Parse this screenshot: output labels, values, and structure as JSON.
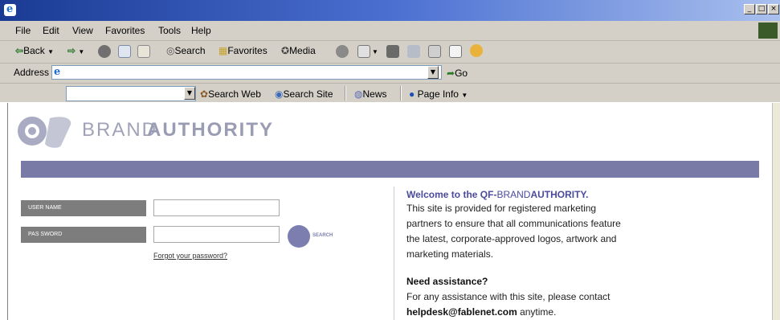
{
  "window": {
    "min_glyph": "_",
    "max_glyph": "□",
    "close_glyph": "×"
  },
  "menu": [
    "File",
    "Edit",
    "View",
    "Favorites",
    "Tools",
    "Help"
  ],
  "toolbar": {
    "back": "Back",
    "search": "Search",
    "favorites": "Favorites",
    "media": "Media"
  },
  "address": {
    "label": "Address",
    "value": "",
    "go": "Go"
  },
  "searchbar": {
    "combo_value": "",
    "search_web": "Search Web",
    "search_site": "Search Site",
    "news": "News",
    "page_info": "Page Info"
  },
  "logo": {
    "text_brand": "BRAND",
    "text_authority": "AUTHORITY"
  },
  "login": {
    "username_label": "USER NAME",
    "username_value": "",
    "password_label": "PAS SWORD",
    "password_value": "",
    "search_label": "SEARCH",
    "forgot": "Forgot your password?"
  },
  "welcome": {
    "title_prefix": "Welcome to the QF-",
    "title_brand": "BRAND",
    "title_authority": "AUTHORITY.",
    "lines": [
      "This site is provided for registered marketing",
      "partners to ensure that all communications feature",
      "the latest, corporate-approved logos, artwork and",
      "marketing materials."
    ],
    "assist_heading": "Need assistance?",
    "assist_line": "For any assistance with this site, please contact",
    "email": "helpdesk@fablenet.com",
    "anytime": " anytime."
  },
  "colors": {
    "brand_purple": "#7a7aa6",
    "title_blue": "#4a4a9e",
    "label_gray": "#7d7d7d"
  }
}
